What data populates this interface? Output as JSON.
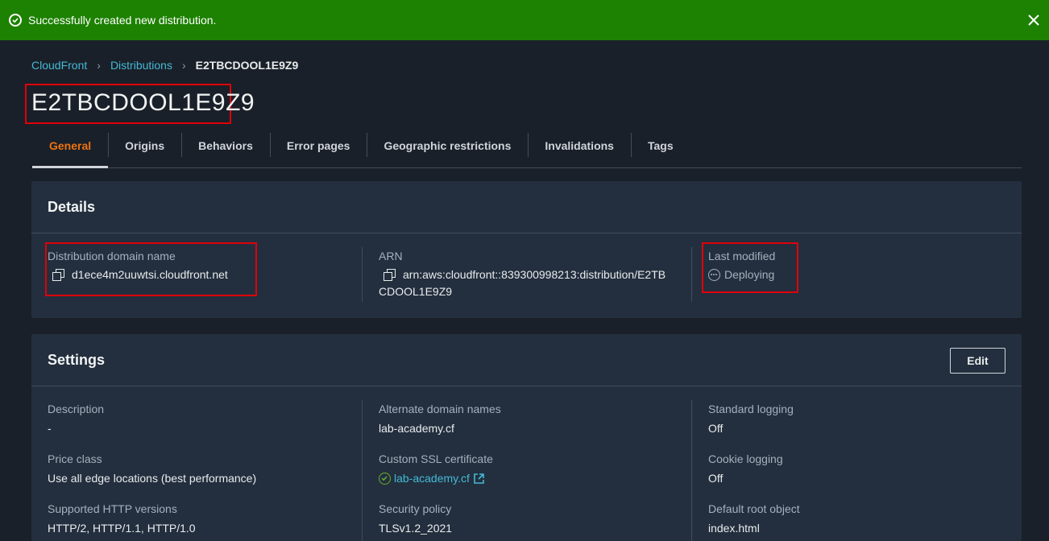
{
  "flash": {
    "message": "Successfully created new distribution."
  },
  "breadcrumb": [
    "CloudFront",
    "Distributions",
    "E2TBCDOOL1E9Z9"
  ],
  "page_title": "E2TBCDOOL1E9Z9",
  "tabs": [
    "General",
    "Origins",
    "Behaviors",
    "Error pages",
    "Geographic restrictions",
    "Invalidations",
    "Tags"
  ],
  "details": {
    "heading": "Details",
    "domain_label": "Distribution domain name",
    "domain_value": "d1ece4m2uuwtsi.cloudfront.net",
    "arn_label": "ARN",
    "arn_line1": "arn:aws:cloudfront::839300998213:distribution/E2TB",
    "arn_line2": "CDOOL1E9Z9",
    "modified_label": "Last modified",
    "modified_value": "Deploying"
  },
  "settings": {
    "heading": "Settings",
    "edit_label": "Edit",
    "description_label": "Description",
    "description_value": "-",
    "price_label": "Price class",
    "price_value": "Use all edge locations (best performance)",
    "http_label": "Supported HTTP versions",
    "http_value": "HTTP/2, HTTP/1.1, HTTP/1.0",
    "alt_label": "Alternate domain names",
    "alt_value": "lab-academy.cf",
    "ssl_label": "Custom SSL certificate",
    "ssl_value": "lab-academy.cf",
    "policy_label": "Security policy",
    "policy_value": "TLSv1.2_2021",
    "logging_label": "Standard logging",
    "logging_value": "Off",
    "cookie_label": "Cookie logging",
    "cookie_value": "Off",
    "root_label": "Default root object",
    "root_value": "index.html"
  },
  "colors": {
    "success": "#1d8102",
    "accent": "#ec7211",
    "link": "#44b9d6",
    "highlight": "#e0000a"
  }
}
